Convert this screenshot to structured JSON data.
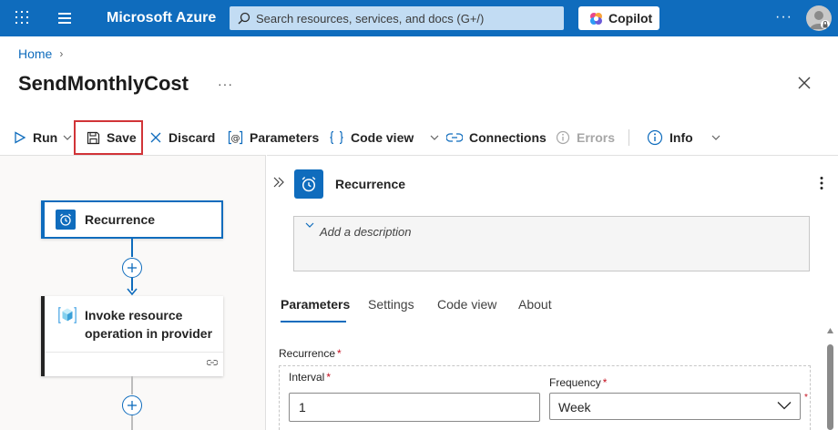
{
  "topbar": {
    "brand": "Microsoft Azure",
    "search_placeholder": "Search resources, services, and docs (G+/)",
    "copilot_label": "Copilot",
    "more": "···"
  },
  "header": {
    "breadcrumb_home": "Home",
    "title": "SendMonthlyCost",
    "title_more": "···"
  },
  "toolbar": {
    "run": "Run",
    "save": "Save",
    "discard": "Discard",
    "parameters": "Parameters",
    "code_view": "Code view",
    "connections": "Connections",
    "errors": "Errors",
    "info": "Info"
  },
  "canvas": {
    "recurrence_title": "Recurrence",
    "invoke_title_line1": "Invoke resource",
    "invoke_title_line2": "operation in provider"
  },
  "panel": {
    "title": "Recurrence",
    "description_placeholder": "Add a description",
    "tabs": [
      "Parameters",
      "Settings",
      "Code view",
      "About"
    ],
    "active_tab": "Parameters",
    "section_label": "Recurrence",
    "interval_label": "Interval",
    "interval_value": "1",
    "frequency_label": "Frequency",
    "frequency_value": "Week",
    "required_mark": "*"
  },
  "colors": {
    "brand_blue": "#0f6cbd",
    "highlight_red": "#d13438",
    "required_red": "#c50f1f"
  }
}
